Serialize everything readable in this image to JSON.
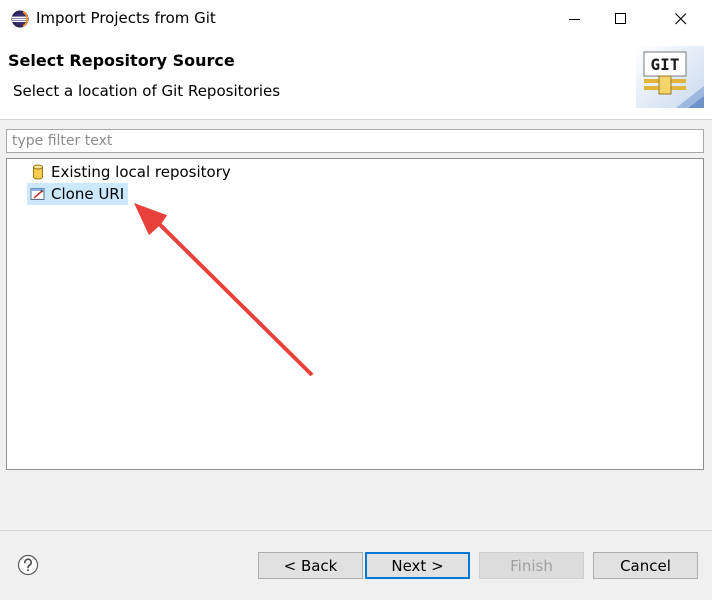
{
  "window": {
    "title": "Import Projects from Git",
    "app_icon": "eclipse-icon",
    "controls": [
      "minimize-icon",
      "maximize-icon",
      "close-icon"
    ]
  },
  "header": {
    "title": "Select Repository Source",
    "description": "Select a location of Git Repositories",
    "banner_icon": "git-banner-icon",
    "banner_text": "GIT"
  },
  "filter": {
    "placeholder": "type filter text",
    "value": ""
  },
  "tree": {
    "items": [
      {
        "label": "Existing local repository",
        "icon": "repository-icon",
        "selected": false
      },
      {
        "label": "Clone URI",
        "icon": "clone-uri-icon",
        "selected": true
      }
    ]
  },
  "annotation": {
    "type": "arrow",
    "color": "#e8403a",
    "points_to": "Clone URI"
  },
  "footer": {
    "help_icon": "help-icon",
    "back_label": "< Back",
    "next_label": "Next >",
    "finish_label": "Finish",
    "cancel_label": "Cancel",
    "finish_enabled": false
  },
  "colors": {
    "selection": "#cce8ff",
    "default_button_border": "#0078d7",
    "dialog_background": "#f0f0f0"
  }
}
